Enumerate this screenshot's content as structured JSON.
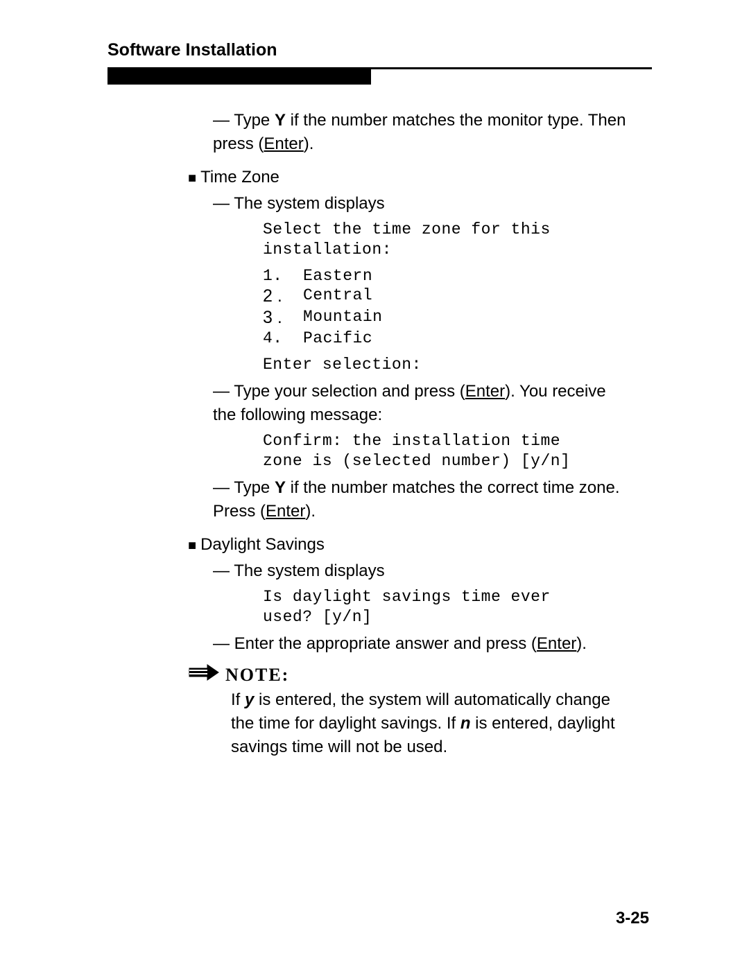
{
  "header": {
    "title": "Software Installation"
  },
  "s0": {
    "dash": "—",
    "type_word": "Type",
    "y_key": "Y",
    "tail1": "if the number matches the monitor type. Then",
    "press_word": "press (",
    "enter": "Enter",
    "close": ")."
  },
  "tz": {
    "bullet": "■",
    "heading": "Time  Zone",
    "dash": "—",
    "sys_displays": "The system displays",
    "line1": "Select the time zone for this",
    "line2": "installation:",
    "opts": [
      {
        "n": "1.",
        "label": "Eastern"
      },
      {
        "n": "2 .",
        "label": "Central"
      },
      {
        "n": "3 .",
        "label": "Mountain"
      },
      {
        "n": "4.",
        "label": "Pacific"
      }
    ],
    "enter_sel": "Enter selection:",
    "type_sel_a": "Type your selection and press (",
    "enter": "Enter",
    "type_sel_b": "). You receive",
    "type_sel_c": "the following message:",
    "confirm1": "Confirm:  the installation time",
    "confirm2": "zone is (selected number) [y/n]",
    "match_a": "Type",
    "match_y": "Y",
    "match_b": "if the number matches the correct time zone.",
    "press_word": "Press (",
    "press_enter": "Enter",
    "press_close": ")."
  },
  "ds": {
    "bullet": "■",
    "heading": "Daylight Savings",
    "dash": "—",
    "sys_displays": "The system displays",
    "line1": "Is daylight savings time ever",
    "line2": "used? [y/n]",
    "enter_ans_a": "Enter the appropriate answer and press (",
    "enter": "Enter",
    "enter_ans_b": ")."
  },
  "note": {
    "label": "NOTE:",
    "l1a": "If ",
    "y": "y",
    "l1b": " is entered, the system will automatically change",
    "l2a": "the time for daylight savings. If ",
    "n": "n",
    "l2b": "  is entered, daylight",
    "l3": "savings time will not be used."
  },
  "pagenum": "3-25"
}
